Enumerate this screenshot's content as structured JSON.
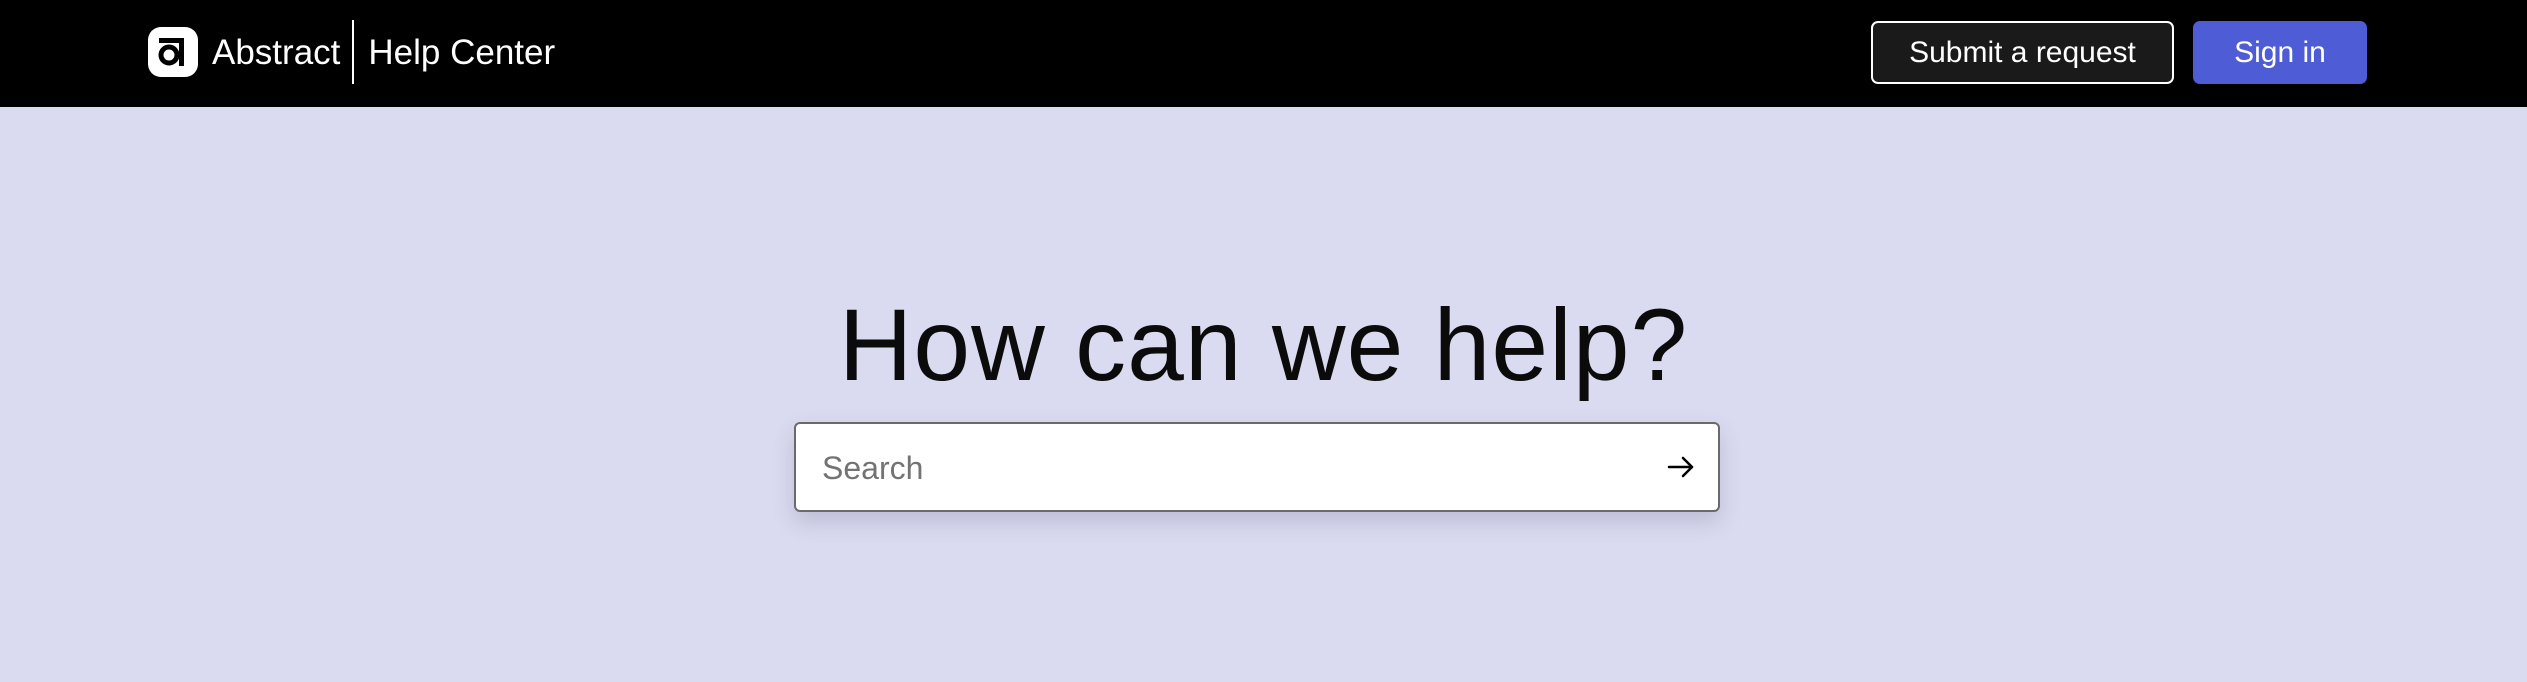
{
  "header": {
    "brand_name": "Abstract",
    "section_name": "Help Center",
    "logo_icon": "abstract-logo-icon",
    "submit_request_label": "Submit a request",
    "sign_in_label": "Sign in"
  },
  "hero": {
    "title": "How can we help?"
  },
  "search": {
    "placeholder": "Search",
    "value": "",
    "submit_icon": "arrow-right-icon"
  },
  "colors": {
    "header_bg": "#000000",
    "page_bg": "#dadaf0",
    "primary_button": "#4e5cd6",
    "secondary_button": "#1a1a1a"
  }
}
